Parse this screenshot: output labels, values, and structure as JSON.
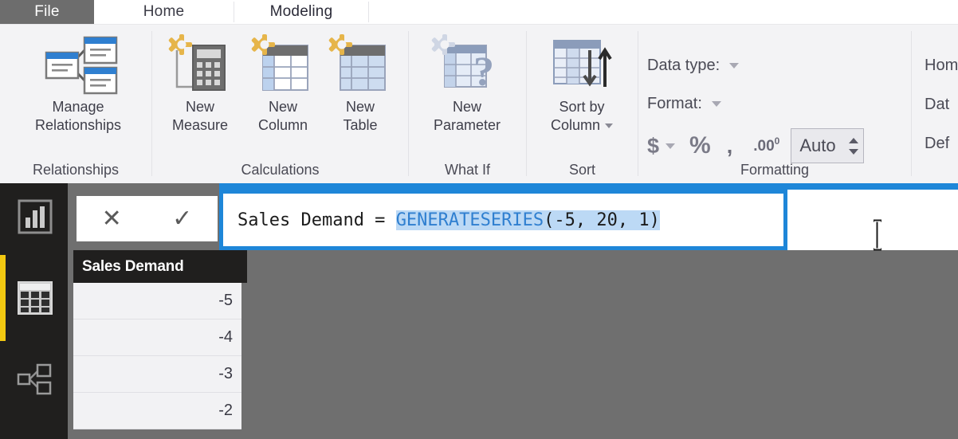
{
  "window": {
    "tabs": [
      {
        "label": "File",
        "state": "file"
      },
      {
        "label": "Home",
        "state": "inactive"
      },
      {
        "label": "Modeling",
        "state": "active"
      }
    ]
  },
  "ribbon": {
    "groups": [
      {
        "name": "relationships",
        "label": "Relationships"
      },
      {
        "name": "calculations",
        "label": "Calculations"
      },
      {
        "name": "what-if",
        "label": "What If"
      },
      {
        "name": "sort",
        "label": "Sort"
      },
      {
        "name": "formatting",
        "label": "Formatting"
      },
      {
        "name": "properties",
        "label": ""
      }
    ],
    "buttons": {
      "manage_relationships": {
        "line1": "Manage",
        "line2": "Relationships",
        "icon": "manage-relationships-icon"
      },
      "new_measure": {
        "line1": "New",
        "line2": "Measure",
        "icon": "new-measure-icon"
      },
      "new_column": {
        "line1": "New",
        "line2": "Column",
        "icon": "new-column-icon"
      },
      "new_table": {
        "line1": "New",
        "line2": "Table",
        "icon": "new-table-icon"
      },
      "new_parameter": {
        "line1": "New",
        "line2": "Parameter",
        "icon": "new-parameter-icon"
      },
      "sort_by_column": {
        "line1": "Sort by",
        "line2": "Column",
        "icon": "sort-by-column-icon",
        "has_caret": true
      }
    },
    "formatting": {
      "data_type_label": "Data type:",
      "format_label": "Format:",
      "currency_symbol": "$",
      "percent_symbol": "%",
      "comma_symbol": ",",
      "decimal_symbol": ".00",
      "decimal_superscript": "0",
      "decimal_places_value": "Auto"
    },
    "properties": {
      "home_table_label": "Hom",
      "data_category_label": "Dat",
      "default_summarization_label": "Def"
    }
  },
  "formula_bar": {
    "cancel_glyph": "✕",
    "commit_glyph": "✓",
    "prefix": "Sales Demand = ",
    "function_name": "GENERATESERIES",
    "arguments": "(-5, 20, 1)",
    "full_text": "Sales Demand = GENERATESERIES(-5, 20, 1)",
    "selected_text": "GENERATESERIES(-5, 20, 1)",
    "border_color": "#1e86d8",
    "selection_color": "#bcd9f5",
    "function_color": "#2f7fd0"
  },
  "left_nav": {
    "items": [
      {
        "name": "report-view",
        "icon": "bar-chart-icon",
        "selected": false
      },
      {
        "name": "data-view",
        "icon": "table-grid-icon",
        "selected": true
      },
      {
        "name": "model-view",
        "icon": "relationship-diagram-icon",
        "selected": false
      }
    ],
    "selection_color": "#f2c811"
  },
  "data_table": {
    "column_header": "Sales Demand",
    "rows": [
      "-5",
      "-4",
      "-3",
      "-2"
    ]
  }
}
